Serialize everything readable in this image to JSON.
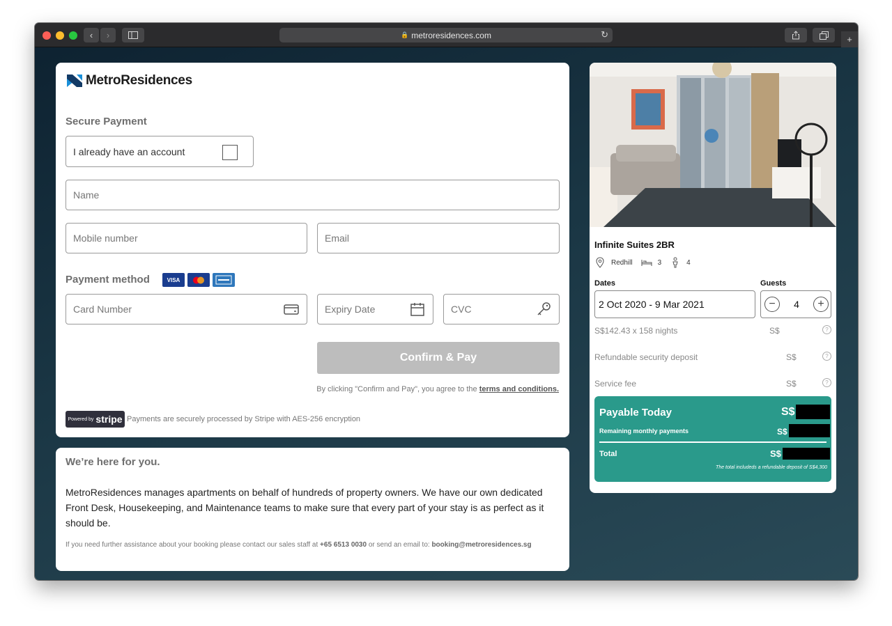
{
  "browser": {
    "url": "metroresidences.com"
  },
  "brand": {
    "name": "MetroResidences"
  },
  "payment": {
    "section_title": "Secure Payment",
    "account_checkbox_label": "I already have an account",
    "name_placeholder": "Name",
    "mobile_placeholder": "Mobile number",
    "email_placeholder": "Email",
    "method_title": "Payment method",
    "cards": [
      "VISA",
      "MC",
      "AMEX"
    ],
    "card_number_placeholder": "Card Number",
    "expiry_placeholder": "Expiry Date",
    "cvc_placeholder": "CVC",
    "confirm_label": "Confirm & Pay",
    "terms_prefix": "By clicking \"Confirm and Pay\", you agree to the",
    "terms_link": "terms and conditions.",
    "stripe_small": "Powered by",
    "stripe_big": "stripe",
    "stripe_note": "Payments are securely processed by Stripe with AES-256 encryption"
  },
  "help": {
    "title": "We’re here for you.",
    "body": "MetroResidences manages apartments on behalf of hundreds of property owners. We have our own dedicated Front Desk, Housekeeping, and Maintenance teams to make sure that every part of your stay is as perfect as it should be.",
    "contact_prefix": "If you need further assistance about your booking please contact our sales staff at",
    "phone": "+65 6513 0030",
    "contact_mid": "or send an email to:",
    "email": "booking@metroresidences.sg"
  },
  "property": {
    "name": "Infinite Suites 2BR",
    "location": "Redhill",
    "beds": "3",
    "guests_max": "4",
    "dates_label": "Dates",
    "dates_value": "2 Oct 2020 - 9 Mar 2021",
    "guests_label": "Guests",
    "guests_value": "4",
    "nights_line": "S$142.43 x 158 nights",
    "deposit_line": "Refundable security deposit",
    "service_line": "Service fee",
    "currency": "S$",
    "payable_title": "Payable Today",
    "remaining_label": "Remaining monthly payments",
    "total_label": "Total",
    "deposit_note": "The total includeds a refundable deposit of S$4,300"
  },
  "colors": {
    "teal": "#2a9a8b",
    "button_disabled": "#bdbdbd",
    "brand_blue": "#1a8fd8"
  }
}
